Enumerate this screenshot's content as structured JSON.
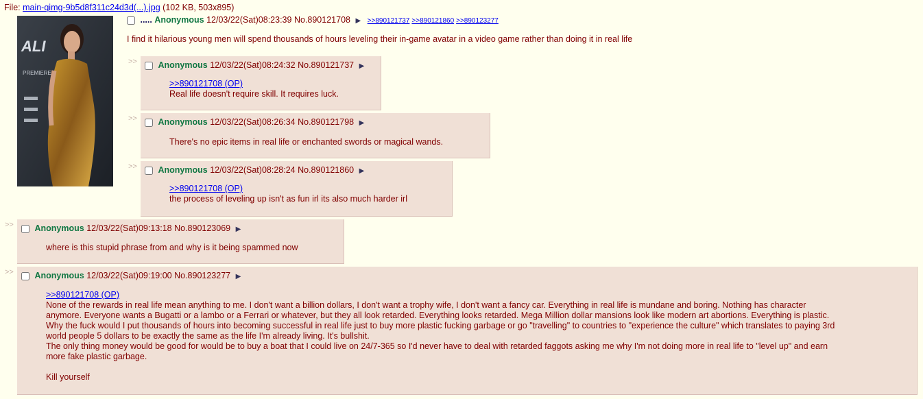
{
  "file": {
    "prefix": "File: ",
    "name": "main-qimg-9b5d8f311c24d3d(...).jpg",
    "meta": " (102 KB, 503x895)"
  },
  "op": {
    "subject": ".....",
    "name": "Anonymous",
    "date": "12/03/22(Sat)08:23:39",
    "no": "No.890121708",
    "backlinks": [
      ">>890121737",
      ">>890121860",
      ">>890123277"
    ],
    "message": "I find it hilarious young men will spend thousands of hours leveling their in-game avatar in a video game rather than doing it in real life"
  },
  "side_marker": ">>",
  "replies": [
    {
      "name": "Anonymous",
      "date": "12/03/22(Sat)08:24:32",
      "no": "No.890121737",
      "quote": ">>890121708 (OP)",
      "lines": [
        "Real life doesn't require skill. It requires luck."
      ]
    },
    {
      "name": "Anonymous",
      "date": "12/03/22(Sat)08:26:34",
      "no": "No.890121798",
      "quote": "",
      "lines": [
        "There's no epic items in real life or enchanted swords or magical wands."
      ]
    },
    {
      "name": "Anonymous",
      "date": "12/03/22(Sat)08:28:24",
      "no": "No.890121860",
      "quote": ">>890121708 (OP)",
      "lines": [
        "the process of leveling up isn't as fun irl its also much harder irl"
      ]
    },
    {
      "name": "Anonymous",
      "date": "12/03/22(Sat)09:13:18",
      "no": "No.890123069",
      "quote": "",
      "lines": [
        "where is this stupid phrase from and why is it being spammed now"
      ]
    },
    {
      "name": "Anonymous",
      "date": "12/03/22(Sat)09:19:00",
      "no": "No.890123277",
      "quote": ">>890121708 (OP)",
      "lines": [
        "None of the rewards in real life mean anything to me. I don't want a billion dollars, I don't want a trophy wife, I don't want a fancy car. Everything in real life is mundane and boring. Nothing has character",
        "anymore. Everyone wants a Bugatti or a lambo or a Ferrari or whatever, but they all look retarded. Everything looks retarded. Mega Million dollar mansions look like modern art abortions. Everything is plastic.",
        "Why the fuck would I put thousands of hours into becoming successful in real life just to buy more plastic fucking garbage or go \"travelling\" to countries to \"experience the culture\" which translates to paying 3rd",
        "world people 5 dollars to be exactly the same as the life I'm already living. It's bullshit.",
        "The only thing money would be good for would be to buy a boat that I could live on 24/7-365 so I'd never have to deal with retarded faggots asking me why I'm not doing more in real life to \"level up\" and earn",
        "more fake plastic garbage.",
        "",
        "Kill yourself"
      ]
    }
  ]
}
